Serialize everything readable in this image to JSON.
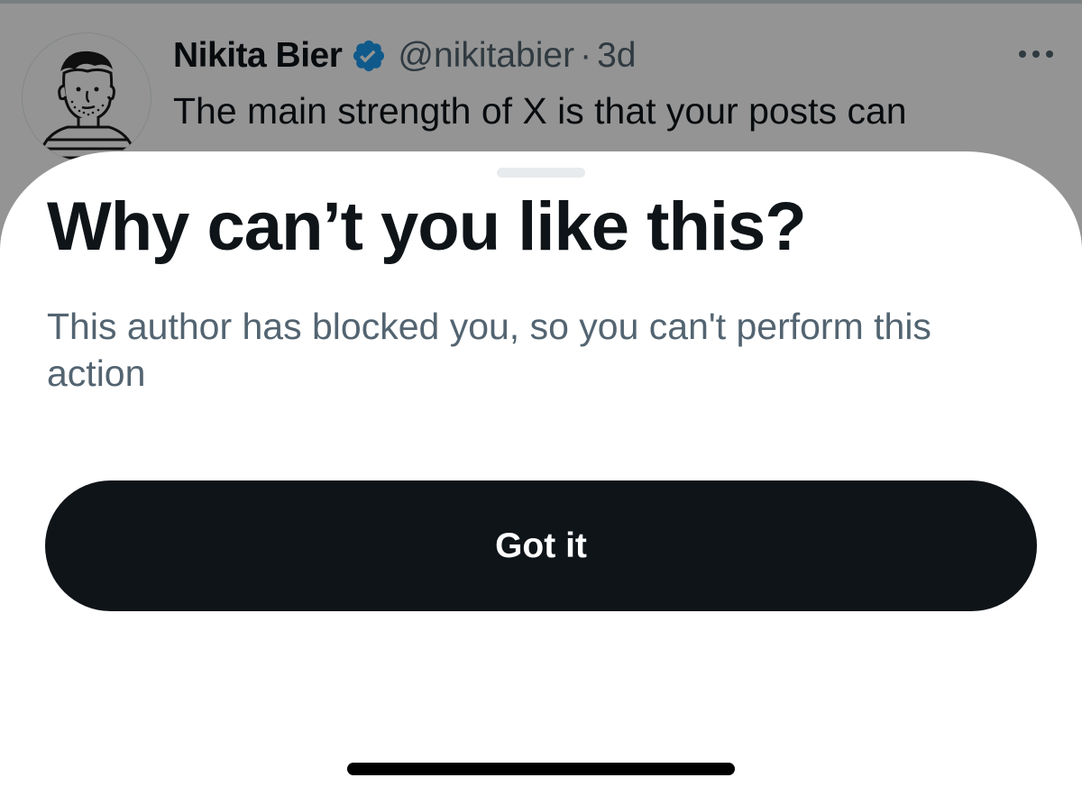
{
  "tweet": {
    "author_name": "Nikita Bier",
    "author_handle": "@nikitabier",
    "separator": "·",
    "time": "3d",
    "text": "The main strength of X is that your posts can",
    "verified_color": "#1d9bf0"
  },
  "sheet": {
    "title": "Why can’t you like this?",
    "description": "This author has blocked you, so you can't perform this action",
    "button_label": "Got it"
  },
  "icons": {
    "avatar": "avatar-illustration",
    "verified": "verified-badge-icon",
    "more": "more-options-icon"
  },
  "colors": {
    "primary_text": "#0f1419",
    "secondary_text": "#536471",
    "button_background": "#0f1419",
    "button_text": "#ffffff"
  }
}
